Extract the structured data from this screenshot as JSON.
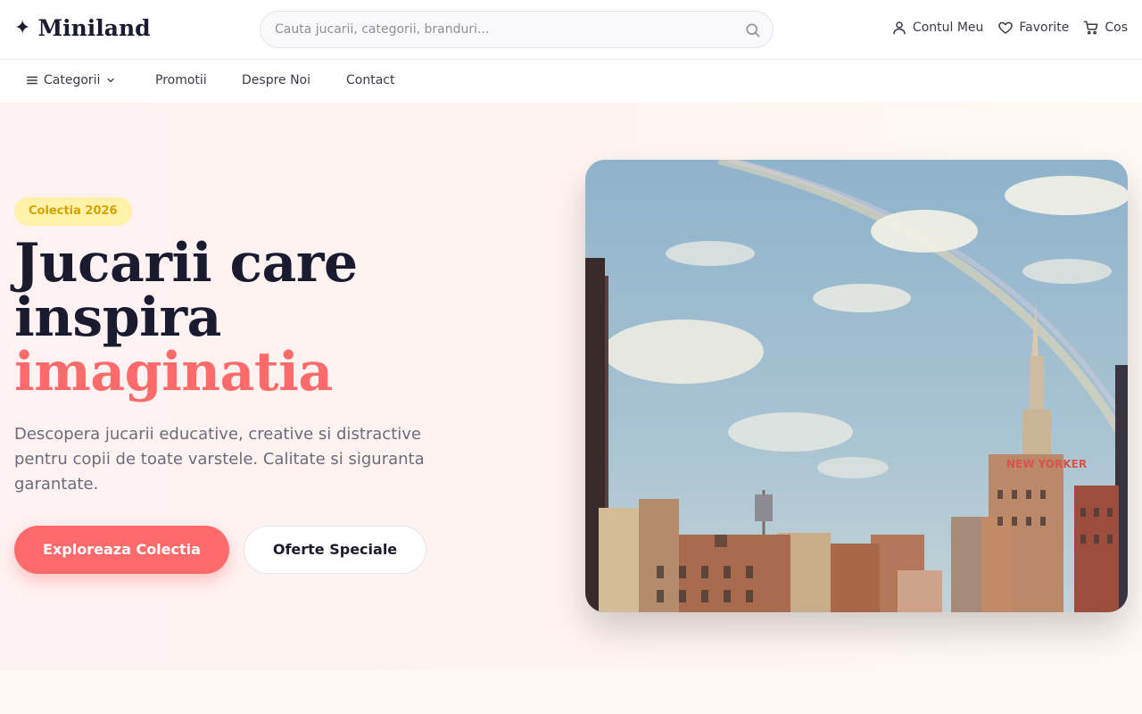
{
  "brand": {
    "name": "Miniland",
    "icon": "sparkle-icon"
  },
  "search": {
    "placeholder": "Cauta jucarii, categorii, branduri...",
    "value": ""
  },
  "account_actions": [
    {
      "label": "Contul Meu",
      "icon": "user-icon"
    },
    {
      "label": "Favorite",
      "icon": "heart-icon"
    },
    {
      "label": "Cos",
      "icon": "cart-icon"
    }
  ],
  "nav": {
    "categories_label": "Categorii",
    "items": [
      "Promotii",
      "Despre Noi",
      "Contact"
    ]
  },
  "hero": {
    "badge": "Colectia 2026",
    "headline_line1": "Jucarii care",
    "headline_line2": "inspira",
    "headline_accent": "imaginatia",
    "description": "Descopera jucarii educative, creative si distractive pentru copii de toate varstele. Calitate si siguranta garantate.",
    "primary_cta": "Exploreaza Colectia",
    "secondary_cta": "Oferte Speciale",
    "image_sign_text": "NEW YORKER"
  },
  "colors": {
    "accent": "#ff6b6b",
    "badge_bg": "#fff1a8",
    "badge_text": "#d6a300",
    "text_dark": "#1b1b2f",
    "text_muted": "#6b6b7a"
  }
}
